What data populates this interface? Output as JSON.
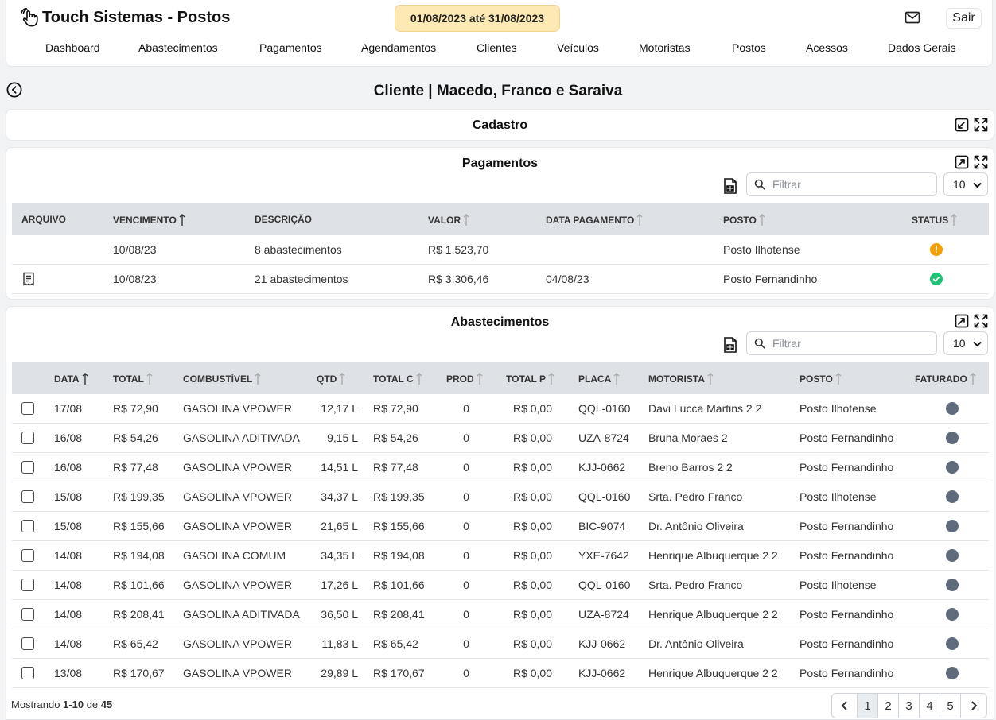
{
  "app": {
    "title": "Touch Sistemas - Postos",
    "period": "01/08/2023 até 31/08/2023",
    "logout_label": "Sair"
  },
  "nav": [
    "Dashboard",
    "Abastecimentos",
    "Pagamentos",
    "Agendamentos",
    "Clientes",
    "Veículos",
    "Motoristas",
    "Postos",
    "Acessos",
    "Dados Gerais"
  ],
  "page": {
    "title": "Cliente | Macedo, Franco e Saraiva"
  },
  "cadastro": {
    "title": "Cadastro"
  },
  "pagamentos": {
    "title": "Pagamentos",
    "filter_placeholder": "Filtrar",
    "page_size": "10",
    "columns": [
      "ARQUIVO",
      "VENCIMENTO",
      "DESCRIÇÃO",
      "VALOR",
      "DATA PAGAMENTO",
      "POSTO",
      "STATUS"
    ],
    "rows": [
      {
        "arquivo": "",
        "vencimento": "10/08/23",
        "descricao": "8 abastecimentos",
        "valor": "R$ 1.523,70",
        "data_pagamento": "",
        "posto": "Posto Ilhotense",
        "status": "pending"
      },
      {
        "arquivo": "receipt-icon",
        "vencimento": "10/08/23",
        "descricao": "21 abastecimentos",
        "valor": "R$ 3.306,46",
        "data_pagamento": "04/08/23",
        "posto": "Posto Fernandinho",
        "status": "paid"
      }
    ],
    "status_colors": {
      "pending": "#f59f00",
      "paid": "#20c374"
    }
  },
  "abastecimentos": {
    "title": "Abastecimentos",
    "filter_placeholder": "Filtrar",
    "page_size": "10",
    "columns": [
      "DATA",
      "TOTAL",
      "COMBUSTÍVEL",
      "QTD",
      "TOTAL C",
      "PROD",
      "TOTAL P",
      "PLACA",
      "MOTORISTA",
      "POSTO",
      "FATURADO"
    ],
    "rows": [
      {
        "data": "17/08",
        "total": "R$ 72,90",
        "combustivel": "GASOLINA VPOWER",
        "qtd": "12,17 L",
        "total_c": "R$ 72,90",
        "prod": "0",
        "total_p": "R$ 0,00",
        "placa": "QQL-0160",
        "motorista": "Davi Lucca Martins 2 2",
        "posto": "Posto Ilhotense"
      },
      {
        "data": "16/08",
        "total": "R$ 54,26",
        "combustivel": "GASOLINA ADITIVADA",
        "qtd": "9,15 L",
        "total_c": "R$ 54,26",
        "prod": "0",
        "total_p": "R$ 0,00",
        "placa": "UZA-8724",
        "motorista": "Bruna Moraes 2",
        "posto": "Posto Fernandinho"
      },
      {
        "data": "16/08",
        "total": "R$ 77,48",
        "combustivel": "GASOLINA VPOWER",
        "qtd": "14,51 L",
        "total_c": "R$ 77,48",
        "prod": "0",
        "total_p": "R$ 0,00",
        "placa": "KJJ-0662",
        "motorista": "Breno Barros 2 2",
        "posto": "Posto Fernandinho"
      },
      {
        "data": "15/08",
        "total": "R$ 199,35",
        "combustivel": "GASOLINA VPOWER",
        "qtd": "34,37 L",
        "total_c": "R$ 199,35",
        "prod": "0",
        "total_p": "R$ 0,00",
        "placa": "QQL-0160",
        "motorista": "Srta. Pedro Franco",
        "posto": "Posto Ilhotense"
      },
      {
        "data": "15/08",
        "total": "R$ 155,66",
        "combustivel": "GASOLINA VPOWER",
        "qtd": "21,65 L",
        "total_c": "R$ 155,66",
        "prod": "0",
        "total_p": "R$ 0,00",
        "placa": "BIC-9074",
        "motorista": "Dr. Antônio Oliveira",
        "posto": "Posto Fernandinho"
      },
      {
        "data": "14/08",
        "total": "R$ 194,08",
        "combustivel": "GASOLINA COMUM",
        "qtd": "34,35 L",
        "total_c": "R$ 194,08",
        "prod": "0",
        "total_p": "R$ 0,00",
        "placa": "YXE-7642",
        "motorista": "Henrique Albuquerque 2 2",
        "posto": "Posto Fernandinho"
      },
      {
        "data": "14/08",
        "total": "R$ 101,66",
        "combustivel": "GASOLINA VPOWER",
        "qtd": "17,26 L",
        "total_c": "R$ 101,66",
        "prod": "0",
        "total_p": "R$ 0,00",
        "placa": "QQL-0160",
        "motorista": "Srta. Pedro Franco",
        "posto": "Posto Ilhotense"
      },
      {
        "data": "14/08",
        "total": "R$ 208,41",
        "combustivel": "GASOLINA ADITIVADA",
        "qtd": "36,50 L",
        "total_c": "R$ 208,41",
        "prod": "0",
        "total_p": "R$ 0,00",
        "placa": "UZA-8724",
        "motorista": "Henrique Albuquerque 2 2",
        "posto": "Posto Fernandinho"
      },
      {
        "data": "14/08",
        "total": "R$ 65,42",
        "combustivel": "GASOLINA VPOWER",
        "qtd": "11,83 L",
        "total_c": "R$ 65,42",
        "prod": "0",
        "total_p": "R$ 0,00",
        "placa": "KJJ-0662",
        "motorista": "Dr. Antônio Oliveira",
        "posto": "Posto Fernandinho"
      },
      {
        "data": "13/08",
        "total": "R$ 170,67",
        "combustivel": "GASOLINA VPOWER",
        "qtd": "29,89 L",
        "total_c": "R$ 170,67",
        "prod": "0",
        "total_p": "R$ 0,00",
        "placa": "KJJ-0662",
        "motorista": "Henrique Albuquerque 2 2",
        "posto": "Posto Fernandinho"
      }
    ],
    "faturado_color": "#5f6b7a",
    "footer": {
      "prefix": "Mostrando",
      "range": "1-10",
      "de": "de",
      "total": "45"
    },
    "pages": [
      "1",
      "2",
      "3",
      "4",
      "5"
    ],
    "current_page": "1"
  }
}
